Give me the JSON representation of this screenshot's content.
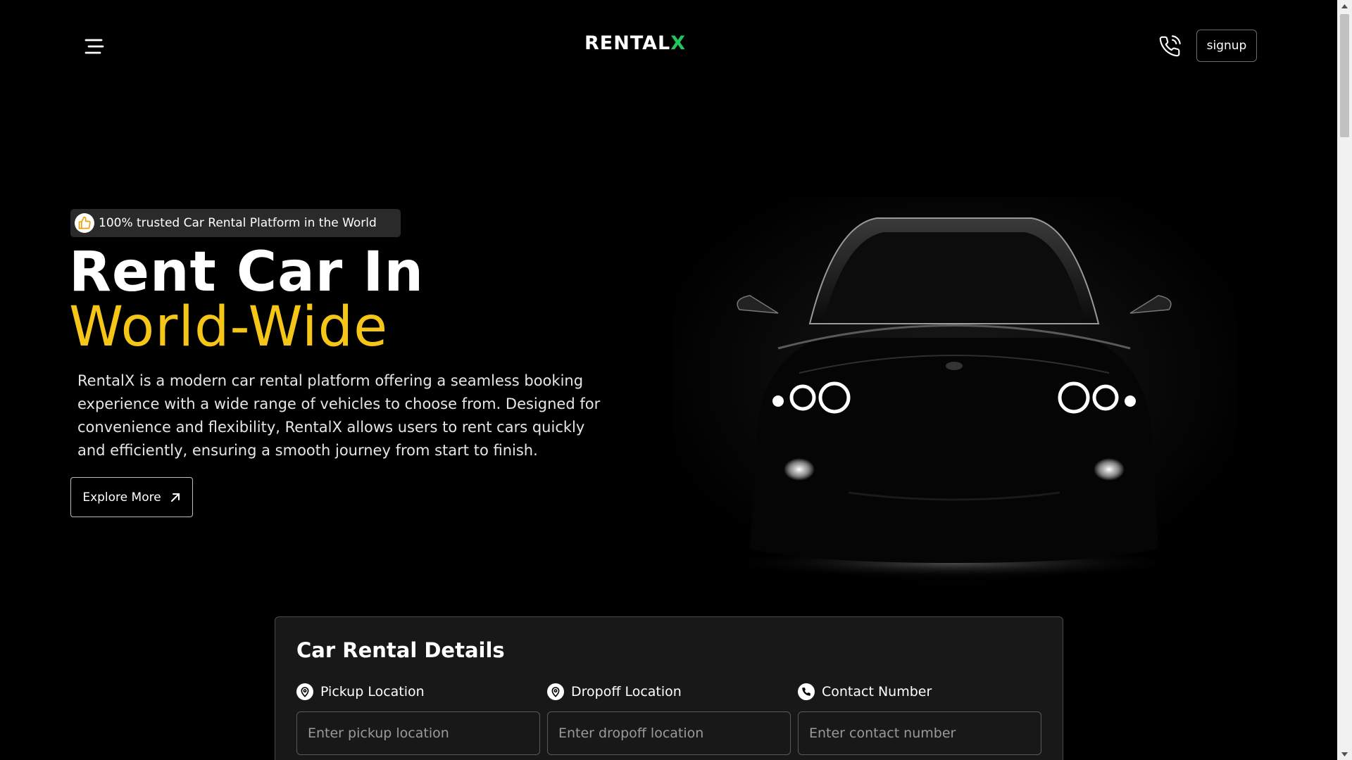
{
  "header": {
    "logo_text": "RENTAL",
    "logo_accent": "X",
    "signup_label": "signup"
  },
  "hero": {
    "badge_text": "100% trusted Car Rental Platform in the World",
    "title_white": "Rent Car In ",
    "title_yellow": "World-Wide",
    "description": "RentalX is a modern car rental platform offering a seamless booking experience with a wide range of vehicles to choose from. Designed for convenience and flexibility, RentalX allows users to rent cars quickly and efficiently, ensuring a smooth journey from start to finish.",
    "cta_label": "Explore More"
  },
  "rental": {
    "title": "Car Rental Details",
    "pickup": {
      "label": "Pickup Location",
      "placeholder": "Enter pickup location"
    },
    "dropoff": {
      "label": "Dropoff Location",
      "placeholder": "Enter dropoff location"
    },
    "contact": {
      "label": "Contact Number",
      "placeholder": "Enter contact number"
    }
  },
  "icons": {
    "menu": "menu-icon",
    "phone": "phone-icon",
    "thumbs_up": "thumbs-up-icon",
    "arrow": "arrow-up-right-icon",
    "location": "location-pin-icon",
    "contact": "phone-icon"
  },
  "colors": {
    "background": "#000000",
    "accent_yellow": "#f5c518",
    "logo_green": "#22c55e",
    "card_bg": "#181818"
  }
}
